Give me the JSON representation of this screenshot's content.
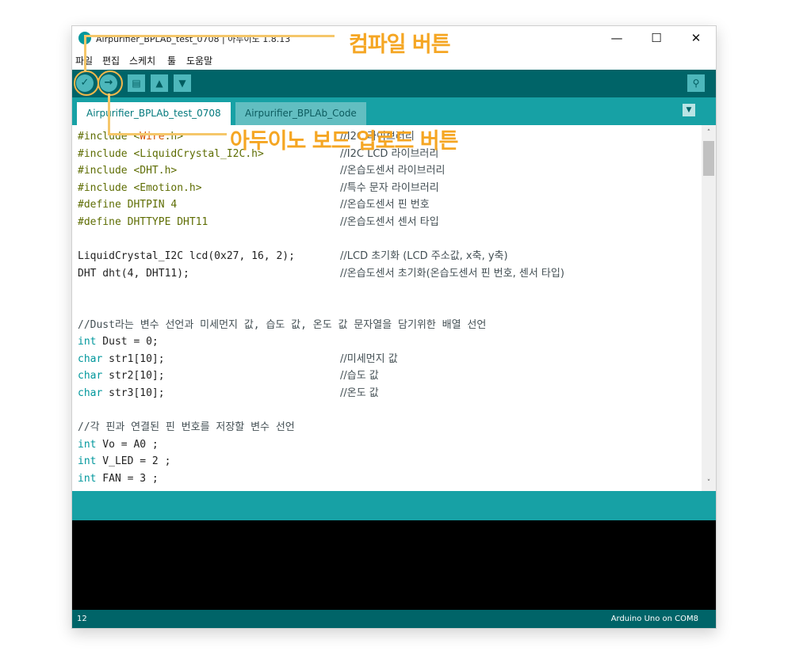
{
  "window": {
    "title": "Airpurifier_BPLAb_test_0708 | 아두이노 1.8.13",
    "minimize_glyph": "—",
    "maximize_glyph": "☐",
    "close_glyph": "✕"
  },
  "menu": [
    "파일",
    "편집",
    "스케치",
    "툴",
    "도움말"
  ],
  "toolbar": {
    "verify": "✓",
    "upload": "→",
    "new": "▤",
    "open": "▲",
    "save": "▼",
    "serial_monitor": "⚲"
  },
  "tabs": [
    {
      "label": "Airpurifier_BPLAb_test_0708",
      "active": true
    },
    {
      "label": "Airpurifier_BPLAb_Code",
      "active": false
    }
  ],
  "tab_menu_glyph": "▼",
  "code": [
    {
      "pre": "#include <",
      "kw": "Wire",
      "post": ".h>",
      "comment": "//I2C 라이브러리"
    },
    {
      "pre": "#include <LiquidCrystal_I2C.h>",
      "kw": "",
      "post": "",
      "comment": "//I2C LCD 라이브러리"
    },
    {
      "pre": "#include <DHT.h>",
      "kw": "",
      "post": "",
      "comment": "//온습도센서 라이브러리"
    },
    {
      "pre": "#include <Emotion.h>",
      "kw": "",
      "post": "",
      "comment": "//특수 문자 라이브러리"
    },
    {
      "pre": "#define DHTPIN 4",
      "kw": "",
      "post": "",
      "comment": "//온습도센서 핀 번호"
    },
    {
      "pre": "#define DHTTYPE DHT11",
      "kw": "",
      "post": "",
      "comment": "//온습도센서 센서 타입"
    },
    {
      "pre": "",
      "kw": "",
      "post": "",
      "comment": ""
    },
    {
      "pre": "LiquidCrystal_I2C lcd(0x27, 16, 2);",
      "kw": "",
      "post": "",
      "comment": "//LCD 초기화 (LCD 주소값, x축, y축)"
    },
    {
      "pre": "DHT dht(4, DHT11);",
      "kw": "",
      "post": "",
      "comment": "//온습도센서 초기화(온습도센서 핀 번호, 센서 타입)"
    },
    {
      "pre": "",
      "kw": "",
      "post": "",
      "comment": ""
    },
    {
      "pre": "",
      "kw": "",
      "post": "",
      "comment": ""
    },
    {
      "pre": "//Dust라는 변수 선언과 미세먼지 값, 습도 값, 온도 값 문자열을 담기위한 배열 선언",
      "kw": "",
      "post": "",
      "comment": ""
    },
    {
      "type": "int",
      "pre": " Dust = 0;",
      "comment": ""
    },
    {
      "type": "char",
      "pre": " str1[10];",
      "comment": "//미세먼지 값"
    },
    {
      "type": "char",
      "pre": " str2[10];",
      "comment": "//습도 값"
    },
    {
      "type": "char",
      "pre": " str3[10];",
      "comment": "//온도 값"
    },
    {
      "pre": "",
      "kw": "",
      "post": "",
      "comment": ""
    },
    {
      "pre": "//각 핀과 연결된 핀 번호를 저장할 변수 선언",
      "kw": "",
      "post": "",
      "comment": ""
    },
    {
      "type": "int",
      "pre": " Vo = A0 ;",
      "comment": ""
    },
    {
      "type": "int",
      "pre": " V_LED = 2 ;",
      "comment": ""
    },
    {
      "type": "int",
      "pre": " FAN = 3 ;",
      "comment": ""
    }
  ],
  "scrollbar": {
    "up": "˄",
    "down": "˅"
  },
  "footer": {
    "line": "12",
    "board": "Arduino Uno on COM8"
  },
  "annotations": {
    "compile": "컴파일 버튼",
    "upload": "아두이노 보드 업로드 버튼"
  },
  "colors": {
    "teal_dark": "#006468",
    "teal": "#17a1a5",
    "accent": "#f5a623"
  }
}
